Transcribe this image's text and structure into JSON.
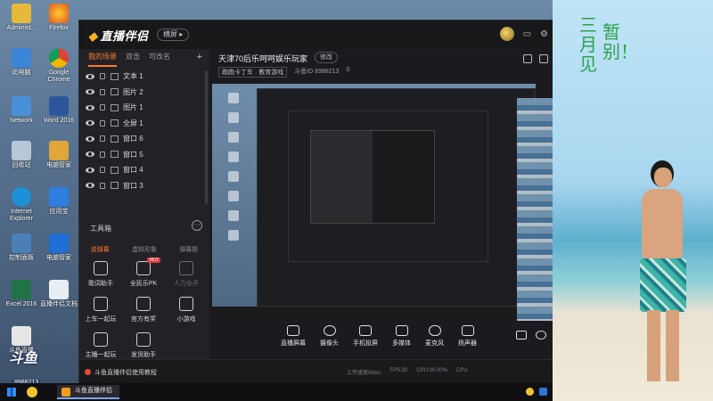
{
  "desktop": {
    "icons": [
      {
        "name": "administrator",
        "label": "Administ..."
      },
      {
        "name": "firefox",
        "label": "Firefox"
      },
      {
        "name": "this-pc",
        "label": "此电脑"
      },
      {
        "name": "chrome",
        "label": "Google Chrome"
      },
      {
        "name": "network",
        "label": "Network"
      },
      {
        "name": "word",
        "label": "Word 2016"
      },
      {
        "name": "recycle-bin",
        "label": "回收站"
      },
      {
        "name": "file-folder",
        "label": "电脑管家"
      },
      {
        "name": "ie",
        "label": "Internet Explorer"
      },
      {
        "name": "apps",
        "label": "应用宝"
      },
      {
        "name": "control-panel",
        "label": "控制面板"
      },
      {
        "name": "security",
        "label": "电脑管家"
      },
      {
        "name": "excel",
        "label": "Excel 2016"
      },
      {
        "name": "doc",
        "label": "直播伴侣文档"
      },
      {
        "name": "douyu-extra",
        "label": "斗鱼直播"
      }
    ]
  },
  "app": {
    "logo": "直播伴侣",
    "mode_pill": "横屏 ▸",
    "tabs": [
      {
        "label": "我的场景",
        "active": true
      },
      {
        "label": "双击",
        "active": false
      },
      {
        "label": "可改名",
        "active": false
      }
    ],
    "add_tab": "+",
    "scenes": [
      {
        "type": "text",
        "label": "文本 1"
      },
      {
        "type": "image",
        "label": "图片 2"
      },
      {
        "type": "image",
        "label": "图片 1"
      },
      {
        "type": "fullscreen",
        "label": "全屏 1"
      },
      {
        "type": "window",
        "label": "窗口 6"
      },
      {
        "type": "window",
        "label": "窗口 5"
      },
      {
        "type": "window",
        "label": "窗口 4"
      },
      {
        "type": "window",
        "label": "窗口 3"
      }
    ],
    "toolbox_title": "工具箱",
    "toolbox_more": "···",
    "tool_tabs": [
      {
        "label": "说弹幕",
        "active": true
      },
      {
        "label": "虚拟形象",
        "active": false
      },
      {
        "label": "弹幕姬",
        "active": false
      }
    ],
    "tools": [
      {
        "label": "歌词助手",
        "dim": false,
        "hot": ""
      },
      {
        "label": "全民乐PK",
        "dim": false,
        "hot": "HOT"
      },
      {
        "label": "人力全开",
        "dim": true,
        "hot": ""
      },
      {
        "label": "上车一起玩",
        "dim": false,
        "hot": ""
      },
      {
        "label": "官方有奖",
        "dim": false,
        "hot": ""
      },
      {
        "label": "小游戏",
        "dim": false,
        "hot": ""
      },
      {
        "label": "主播一起玩",
        "dim": false,
        "hot": ""
      },
      {
        "label": "发货助手",
        "dim": false,
        "hot": ""
      }
    ],
    "room": {
      "title": "天津70后乐呵呵娱乐玩家",
      "edit_label": "修改",
      "category": "跑跑卡丁车 · 教育游戏",
      "id_label": "斗鱼ID 8988213",
      "hot_value": "0"
    },
    "bottom_actions": [
      {
        "name": "screen-share",
        "label": "直播屏幕"
      },
      {
        "name": "camera",
        "label": "摄像头"
      },
      {
        "name": "phone",
        "label": "手机投屏"
      },
      {
        "name": "media",
        "label": "多媒体"
      },
      {
        "name": "mic",
        "label": "麦克风"
      },
      {
        "name": "speaker",
        "label": "扬声器"
      }
    ],
    "status": {
      "tutorial": "斗鱼直播伴侣使用教程",
      "speed": "上传速度0kb/s",
      "fps": "FPS:30",
      "cpu": "CPU:00.00%",
      "cpu2": "CPU"
    }
  },
  "watermark": {
    "brand": "斗鱼",
    "id": "8988213"
  },
  "side_panel": {
    "text_line1": "三月见",
    "text_line2": "暂别！"
  },
  "taskbar": {
    "app_label": "斗鱼直播伴侣"
  },
  "colors": {
    "accent": "#ff7a2c",
    "panel": "#1f1f23",
    "text_green": "#2ea14d"
  }
}
